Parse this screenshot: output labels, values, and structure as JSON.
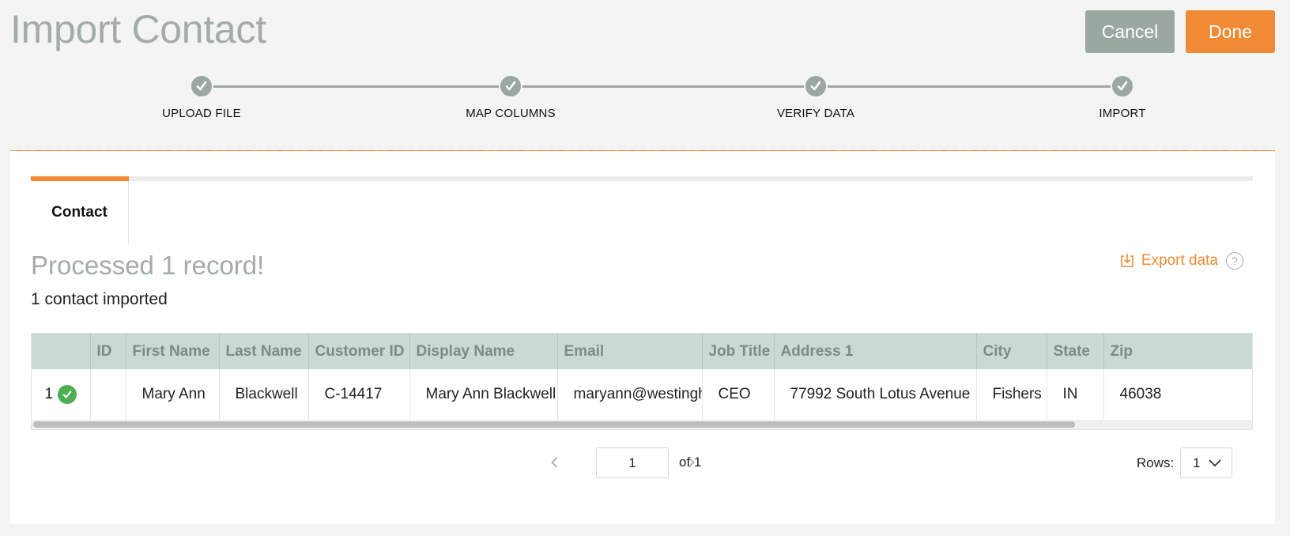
{
  "header": {
    "title": "Import Contact",
    "cancel_label": "Cancel",
    "done_label": "Done"
  },
  "stepper": {
    "steps": [
      "UPLOAD FILE",
      "MAP COLUMNS",
      "VERIFY DATA",
      "IMPORT"
    ]
  },
  "tabs": [
    {
      "label": "Contact",
      "active": true
    }
  ],
  "summary": {
    "processed": "Processed 1 record!",
    "imported": "1 contact imported"
  },
  "export": {
    "label": "Export data",
    "help": "?"
  },
  "table": {
    "columns": [
      "",
      "ID",
      "First Name",
      "Last Name",
      "Customer ID",
      "Display Name",
      "Email",
      "Job Title",
      "Address 1",
      "City",
      "State",
      "Zip"
    ],
    "rows": [
      {
        "num": "1",
        "status": "success",
        "cells": [
          "",
          "Mary Ann",
          "Blackwell",
          "C-14417",
          "Mary Ann Blackwell",
          "maryann@westinghouse.com",
          "CEO",
          "77992 South Lotus Avenue",
          "Fishers",
          "IN",
          "46038"
        ]
      }
    ]
  },
  "pagination": {
    "current_page": "1",
    "of_label": "of 1",
    "rows_label": "Rows:",
    "rows_value": "1"
  },
  "colors": {
    "accent": "#f08a35",
    "muted": "#9aa8a1",
    "success": "#4caf50",
    "header_bg": "#ccd9d1"
  }
}
